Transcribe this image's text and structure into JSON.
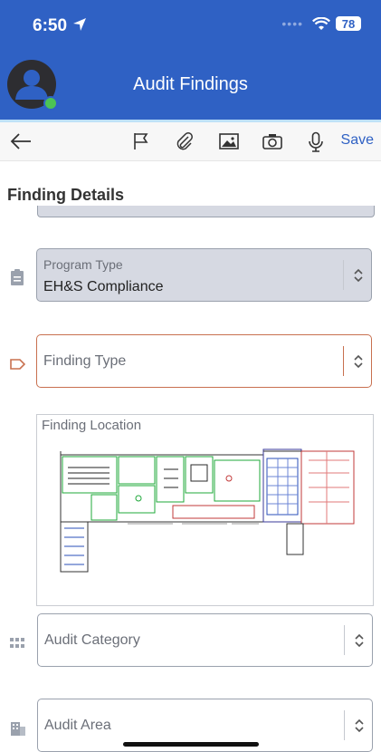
{
  "status_bar": {
    "time": "6:50",
    "battery": "78"
  },
  "header": {
    "title": "Audit Findings"
  },
  "toolbar": {
    "save_label": "Save"
  },
  "section": {
    "title": "Finding Details"
  },
  "fields": {
    "program_type": {
      "label": "Program Type",
      "value": "EH&S Compliance"
    },
    "finding_type": {
      "placeholder": "Finding Type"
    },
    "finding_location": {
      "label": "Finding Location"
    },
    "audit_category": {
      "placeholder": "Audit Category"
    },
    "audit_area": {
      "placeholder": "Audit Area"
    }
  },
  "colors": {
    "header": "#2f61c4",
    "accent": "#2f61c4",
    "active_border": "#c8704f",
    "disabled_bg": "#d6d9e2"
  }
}
